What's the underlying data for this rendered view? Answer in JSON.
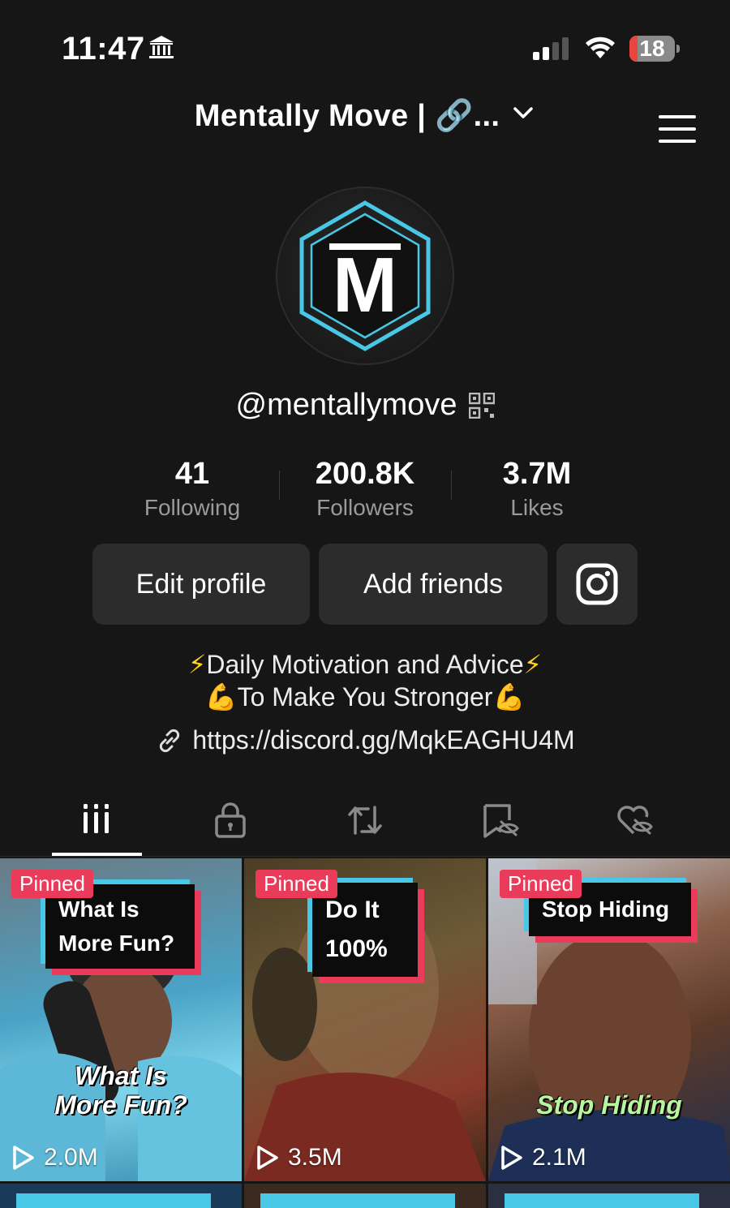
{
  "status_bar": {
    "time": "11:47",
    "battery_level": "18",
    "battery_color": "#e8453c"
  },
  "header": {
    "account_name": "Mentally Move | 🔗...",
    "menu_icon": "hamburger-menu-icon"
  },
  "profile": {
    "avatar_letter": "M",
    "handle": "@mentallymove",
    "stats": [
      {
        "value": "41",
        "label": "Following"
      },
      {
        "value": "200.8K",
        "label": "Followers"
      },
      {
        "value": "3.7M",
        "label": "Likes"
      }
    ],
    "buttons": {
      "edit_profile": "Edit profile",
      "add_friends": "Add friends",
      "instagram_icon": "instagram-icon"
    },
    "bio_line1": "Daily Motivation and Advice",
    "bio_line2": "To Make You Stronger",
    "link": "https://discord.gg/MqkEAGHU4M"
  },
  "tabs": [
    {
      "name": "videos",
      "icon": "grid-icon",
      "active": true
    },
    {
      "name": "private",
      "icon": "lock-icon",
      "active": false
    },
    {
      "name": "reposts",
      "icon": "repost-icon",
      "active": false
    },
    {
      "name": "favorites",
      "icon": "bookmark-hidden-icon",
      "active": false
    },
    {
      "name": "liked",
      "icon": "heart-hidden-icon",
      "active": false
    }
  ],
  "videos": [
    {
      "pinned": "Pinned",
      "card_line1": "What Is",
      "card_line2": "More Fun?",
      "overlay": "What Is More Fun?",
      "views": "2.0M"
    },
    {
      "pinned": "Pinned",
      "card_line1": "Do It",
      "card_line2": "100%",
      "overlay": "",
      "views": "3.5M"
    },
    {
      "pinned": "Pinned",
      "card_line1": "Stop Hiding",
      "card_line2": "",
      "overlay": "Stop Hiding",
      "views": "2.1M"
    }
  ],
  "accent_colors": {
    "pink": "#ea3b5a",
    "cyan": "#48c8e6"
  }
}
